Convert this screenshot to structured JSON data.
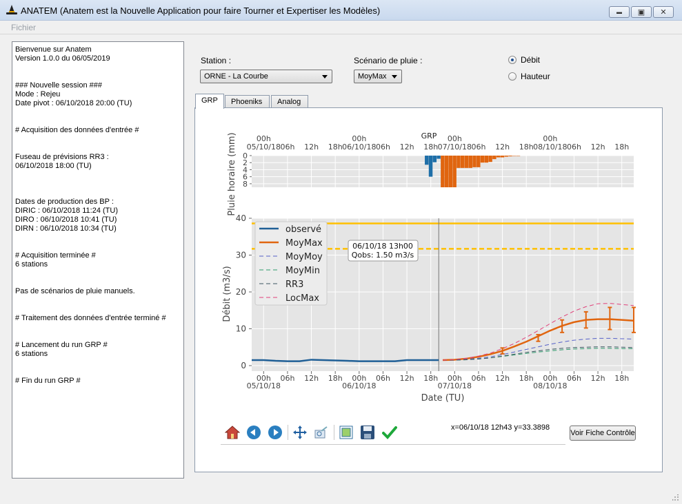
{
  "window": {
    "title": "ANATEM (Anatem est la Nouvelle Application pour faire Tourner et Expertiser les Modèles)",
    "minimize_glyph": "▬",
    "maximize_glyph": "▣",
    "close_glyph": "✕"
  },
  "menu": {
    "fichier": "Fichier"
  },
  "log": {
    "lines": [
      "Bienvenue sur Anatem",
      "Version 1.0.0 du 06/05/2019",
      "",
      "",
      "### Nouvelle session ###",
      "Mode : Rejeu",
      "Date pivot : 06/10/2018 20:00 (TU)",
      "",
      "",
      "# Acquisition des données d'entrée #",
      "",
      "",
      "Fuseau de prévisions RR3 :",
      "06/10/2018 18:00 (TU)",
      "",
      "",
      "",
      "Dates de production des BP :",
      "DIRIC : 06/10/2018 11:24 (TU)",
      "DIRO : 06/10/2018 10:41 (TU)",
      "DIRN : 06/10/2018 10:34 (TU)",
      "",
      "",
      "# Acquisition terminée #",
      "6 stations",
      "",
      "",
      "Pas de scénarios de pluie manuels.",
      "",
      "",
      "# Traitement des données d'entrée terminé #",
      "",
      "",
      "# Lancement du run GRP #",
      "6 stations",
      "",
      "",
      "# Fin du run GRP #"
    ]
  },
  "controls": {
    "station_label": "Station :",
    "station_value": "ORNE - La Courbe",
    "scenario_label": "Scénario de pluie :",
    "scenario_value": "MoyMax",
    "radio_debit": "Débit",
    "radio_hauteur": "Hauteur",
    "selected_radio": "Débit"
  },
  "tabs": [
    "GRP",
    "Phoeniks",
    "Analog"
  ],
  "active_tab": "GRP",
  "chart_data": [
    {
      "type": "bar",
      "title": "GRP",
      "ylabel": "Pluie horaire (mm)",
      "ylim": [
        9,
        0
      ],
      "y_ticks": [
        "0",
        "2",
        "4",
        "6",
        "8"
      ],
      "x_ticks": [
        "00h\n05/10/18",
        "06h",
        "12h",
        "18h",
        "00h\n06/10/18",
        "06h",
        "12h",
        "18h",
        "00h\n07/10/18",
        "06h",
        "12h",
        "18h",
        "00h\n08/10/18",
        "06h",
        "12h",
        "18h"
      ],
      "x_unit": "hours since 05/10/18 00h",
      "xlim": [
        -3,
        93
      ],
      "series": [
        {
          "color": "#1f6fa8",
          "x": [
            41,
            42,
            43,
            44
          ],
          "values": [
            2.6,
            6.0,
            1.9,
            0.9
          ]
        },
        {
          "color": "#e0650f",
          "x": [
            45,
            46,
            47,
            48,
            49,
            50,
            51,
            52,
            53,
            54,
            55,
            56,
            57,
            58,
            59,
            60,
            61,
            62,
            63,
            64
          ],
          "values": [
            9.0,
            9.0,
            9.0,
            9.0,
            3.5,
            3.5,
            3.5,
            3.5,
            3.3,
            3.3,
            2.0,
            2.0,
            1.8,
            1.0,
            0.5,
            0.5,
            0.3,
            0.2,
            0.1,
            0.1
          ]
        }
      ]
    },
    {
      "type": "line",
      "xlabel": "Date (TU)",
      "ylabel": "Débit (m3/s)",
      "ylim": [
        0,
        40
      ],
      "y_ticks": [
        "0",
        "10",
        "20",
        "30",
        "40"
      ],
      "x_ticks": [
        "00h\n05/10/18",
        "06h",
        "12h",
        "18h",
        "00h\n06/10/18",
        "06h",
        "12h",
        "18h",
        "00h\n07/10/18",
        "06h",
        "12h",
        "18h",
        "00h\n08/10/18",
        "06h",
        "12h",
        "18h"
      ],
      "x_unit": "hours since 05/10/18 00h",
      "xlim": [
        -3,
        93
      ],
      "grid": true,
      "legend_position": "top-left",
      "pivot_x": 44,
      "thresholds": [
        {
          "y": 38.6,
          "style": "solid",
          "color": "#ffc000"
        },
        {
          "y": 31.7,
          "style": "dashed",
          "color": "#ffc000"
        }
      ],
      "annotation": {
        "line1": "06/10/18 13h00",
        "line2": "Qobs: 1.50 m3/s"
      },
      "series": [
        {
          "name": "observé",
          "color": "#1f5f96",
          "style": "solid",
          "width": 2.5,
          "x": [
            -3,
            0,
            3,
            6,
            9,
            12,
            15,
            18,
            21,
            24,
            27,
            30,
            33,
            36,
            39,
            42,
            44
          ],
          "y": [
            1.5,
            1.5,
            1.3,
            1.2,
            1.2,
            1.6,
            1.5,
            1.4,
            1.3,
            1.2,
            1.2,
            1.2,
            1.2,
            1.5,
            1.5,
            1.5,
            1.5
          ]
        },
        {
          "name": "MoyMax",
          "color": "#e0650f",
          "style": "solid",
          "width": 2.5,
          "x": [
            45,
            48,
            51,
            54,
            57,
            60,
            63,
            66,
            69,
            72,
            75,
            78,
            81,
            84,
            87,
            90,
            93
          ],
          "y": [
            1.5,
            1.6,
            1.9,
            2.4,
            3.1,
            4.0,
            5.2,
            6.5,
            8.0,
            9.5,
            10.8,
            11.8,
            12.4,
            12.6,
            12.6,
            12.4,
            12.2
          ]
        },
        {
          "name": "MoyMoy",
          "color": "#5560c8",
          "style": "dashed",
          "width": 1,
          "x": [
            45,
            48,
            51,
            54,
            57,
            60,
            63,
            66,
            69,
            72,
            75,
            78,
            81,
            84,
            87,
            90,
            93
          ],
          "y": [
            1.5,
            1.5,
            1.7,
            2.0,
            2.4,
            3.0,
            3.7,
            4.4,
            5.1,
            5.8,
            6.4,
            6.9,
            7.2,
            7.4,
            7.4,
            7.3,
            7.2
          ]
        },
        {
          "name": "MoyMin",
          "color": "#2e9a6b",
          "style": "dashed",
          "width": 1,
          "x": [
            45,
            48,
            51,
            54,
            57,
            60,
            63,
            66,
            69,
            72,
            75,
            78,
            81,
            84,
            87,
            90,
            93
          ],
          "y": [
            1.5,
            1.5,
            1.6,
            1.8,
            2.1,
            2.5,
            2.9,
            3.3,
            3.7,
            4.0,
            4.3,
            4.5,
            4.6,
            4.7,
            4.7,
            4.6,
            4.6
          ]
        },
        {
          "name": "RR3",
          "color": "#3a5560",
          "style": "dashed",
          "width": 1,
          "x": [
            45,
            48,
            51,
            54,
            57,
            60,
            63,
            66,
            69,
            72,
            75,
            78,
            81,
            84,
            87,
            90,
            93
          ],
          "y": [
            1.5,
            1.5,
            1.6,
            1.8,
            2.1,
            2.6,
            3.1,
            3.6,
            4.0,
            4.4,
            4.7,
            4.9,
            5.0,
            5.1,
            5.1,
            5.0,
            4.9
          ]
        },
        {
          "name": "LocMax",
          "color": "#e0407a",
          "style": "dashed",
          "width": 1,
          "x": [
            45,
            48,
            51,
            54,
            57,
            60,
            63,
            66,
            69,
            72,
            75,
            78,
            81,
            84,
            87,
            90,
            93
          ],
          "y": [
            1.5,
            1.6,
            2.0,
            2.6,
            3.4,
            4.6,
            6.0,
            7.7,
            9.5,
            11.4,
            13.2,
            14.8,
            16.0,
            16.8,
            16.9,
            16.6,
            16.3
          ]
        }
      ],
      "error_bars": [
        {
          "x": 60,
          "low": 3.2,
          "high": 4.8
        },
        {
          "x": 69,
          "low": 6.6,
          "high": 8.4
        },
        {
          "x": 75,
          "low": 9.0,
          "high": 12.4
        },
        {
          "x": 81,
          "low": 10.2,
          "high": 14.6
        },
        {
          "x": 87,
          "low": 9.8,
          "high": 15.8
        },
        {
          "x": 93,
          "low": 9.0,
          "high": 15.8
        }
      ]
    }
  ],
  "toolbar": {
    "icons": [
      "home-icon",
      "back-icon",
      "forward-icon",
      "pan-icon",
      "zoom-icon",
      "subplots-icon",
      "save-icon",
      "validate-icon"
    ],
    "coordinates": "x=06/10/18 12h43 y=33.3898",
    "fiche_button": "Voir Fiche Contrôle"
  }
}
